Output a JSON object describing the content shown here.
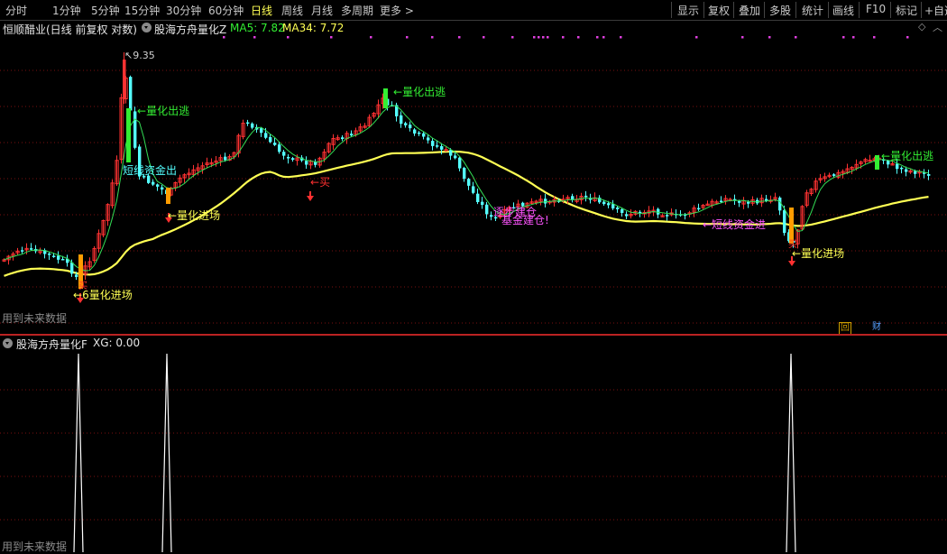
{
  "toolbar": {
    "periods": [
      "分时",
      "1分钟",
      "5分钟",
      "15分钟",
      "30分钟",
      "60分钟",
      "日线",
      "周线",
      "月线",
      "多周期",
      "更多"
    ],
    "active_period": "日线",
    "more_arrow": ">",
    "tools": [
      "显示",
      "复权",
      "叠加",
      "多股",
      "统计",
      "画线",
      "F10",
      "标记",
      "+自选"
    ]
  },
  "main_panel": {
    "stock_title": "恒顺醋业(日线 前复权 对数)",
    "indicator_name": "股海方舟量化Z",
    "ma5_label": "MA5: 7.82",
    "ma34_label": "MA34: 7.72",
    "high_label": "9.35",
    "low_label": "6",
    "future_data_note": "用到未来数据",
    "badge_text": "财",
    "signals": {
      "exit_1": "量化出逃",
      "exit_2": "量化出逃",
      "exit_3": "量化出逃",
      "entry_1": "量化进场",
      "entry_2": "量化进场",
      "entry_3": "量化进场",
      "buy": "买",
      "fund_out": "短线资金出",
      "fund_in": "←短线资金进",
      "mid_1": "逐步建仓",
      "mid_2": "基金建仓!"
    }
  },
  "sub_panel": {
    "indicator_name": "股海方舟量化F",
    "xg_label": "XG: 0.00",
    "future_data_note": "用到未来数据"
  },
  "colors": {
    "up": "#ff3232",
    "down": "#54ffff",
    "ma5": "#ffffff",
    "ma34": "#ffff54",
    "grid": "#7a1010",
    "signal_green": "#33ee33",
    "signal_yellow": "#ffff54",
    "signal_magenta": "#ff55ff"
  }
}
